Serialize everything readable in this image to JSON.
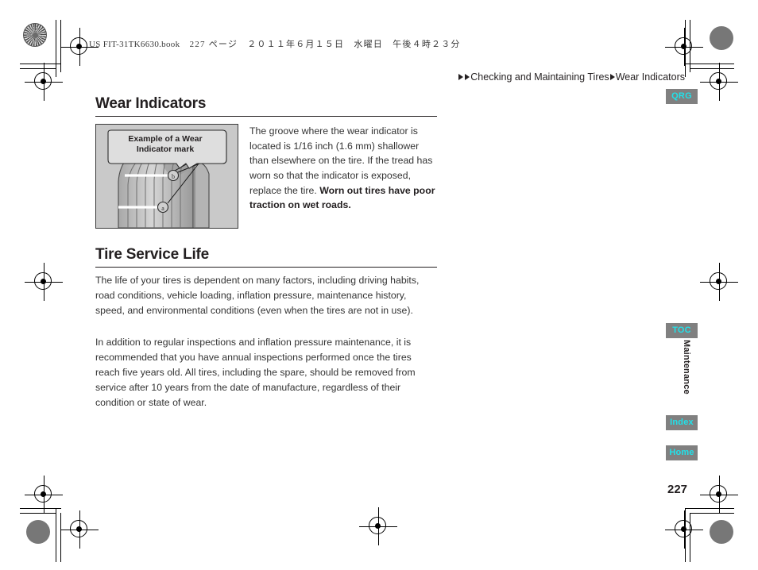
{
  "print_header": {
    "filename": "US FIT-31TK6630.book",
    "page_label": "227 ページ",
    "date": "２０１１年６月１５日　水曜日　午後４時２３分"
  },
  "breadcrumb": {
    "level1": "Checking and Maintaining Tires",
    "level2": "Wear Indicators"
  },
  "sections": {
    "wear_indicators": {
      "heading": "Wear Indicators",
      "figure_caption": "Example of a Wear Indicator mark",
      "body_text": "The groove where the wear indicator is located is 1/16 inch (1.6 mm) shallower than elsewhere on the tire. If the tread has worn so that the indicator is exposed, replace the tire. ",
      "body_bold": "Worn out tires have poor traction on wet roads."
    },
    "tire_service_life": {
      "heading": "Tire Service Life",
      "paragraph1": "The life of your tires is dependent on many factors, including driving habits, road conditions, vehicle loading, inflation pressure, maintenance history, speed, and environmental conditions (even when the tires are not in use).",
      "paragraph2": "In addition to regular inspections and inflation pressure maintenance, it is recommended that you have annual inspections performed once the tires reach five years old. All tires, including the spare, should be removed from service after 10 years from the date of manufacture, regardless of their condition or state of wear."
    }
  },
  "side_tabs": {
    "qrg": "QRG",
    "toc": "TOC",
    "index": "Index",
    "home": "Home",
    "chapter": "Maintenance"
  },
  "page_number": "227",
  "colors": {
    "tab_background": "#808080",
    "tab_text": "#22e0e8",
    "figure_background": "#c9c9c9",
    "text": "#231f20"
  }
}
